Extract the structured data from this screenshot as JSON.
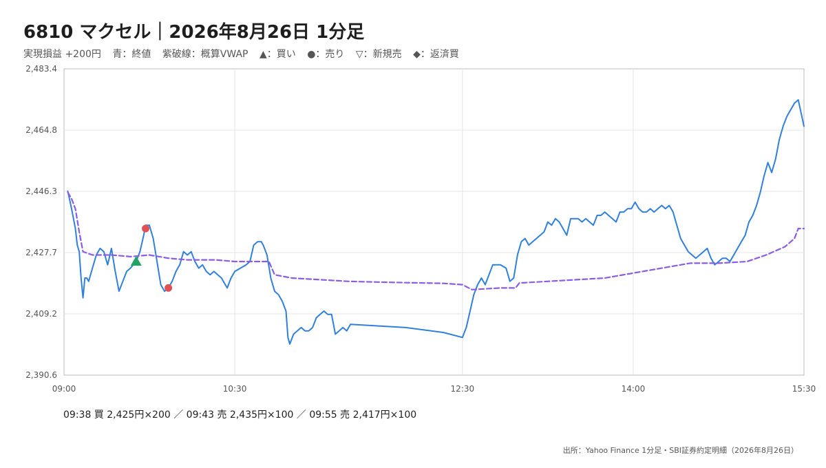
{
  "header": {
    "title": "6810 マクセル｜2026年8月26日 1分足",
    "legend": {
      "pnl": "実現損益 +200円",
      "close": "青：終値",
      "vwap": "紫破線：概算VWAP",
      "buy": "▲：買い",
      "sell": "●：売り",
      "new_sell": "▽：新規売",
      "repay": "◆：返済買"
    }
  },
  "trades_text": "09:38 買 2,425円×200 ／ 09:43 売 2,435円×100 ／ 09:55 売 2,417円×100",
  "source_text": "出所：Yahoo Finance 1分足・SBI証券約定明細（2026年8月26日）",
  "colors": {
    "close": "#2f7fdc",
    "vwap": "#8a5ce6",
    "buy": "#21a366",
    "sell": "#e05252",
    "grid": "#e6e6e6",
    "frame": "#bbbbbb"
  },
  "chart_data": {
    "type": "line",
    "x_axis": {
      "range": [
        "09:00",
        "15:30"
      ],
      "ticks": [
        "09:00",
        "10:30",
        "12:30",
        "14:00",
        "15:30"
      ]
    },
    "y_axis": {
      "range": [
        2390.6,
        2483.4
      ],
      "ticks": [
        "2,390.6",
        "2,409.2",
        "2,427.7",
        "2,446.3",
        "2,464.8",
        "2,483.4"
      ]
    },
    "grid": true,
    "series": [
      {
        "name": "終値",
        "style": "solid",
        "points": [
          [
            "09:02",
            2446.3
          ],
          [
            "09:04",
            2441
          ],
          [
            "09:06",
            2435
          ],
          [
            "09:07",
            2430
          ],
          [
            "09:08",
            2428
          ],
          [
            "09:09",
            2420
          ],
          [
            "09:10",
            2414
          ],
          [
            "09:11",
            2420
          ],
          [
            "09:12",
            2420
          ],
          [
            "09:13",
            2419
          ],
          [
            "09:15",
            2423
          ],
          [
            "09:17",
            2427
          ],
          [
            "09:19",
            2429
          ],
          [
            "09:21",
            2428
          ],
          [
            "09:23",
            2424
          ],
          [
            "09:25",
            2429
          ],
          [
            "09:27",
            2422
          ],
          [
            "09:29",
            2416
          ],
          [
            "09:31",
            2419
          ],
          [
            "09:33",
            2422
          ],
          [
            "09:35",
            2423
          ],
          [
            "09:38",
            2425
          ],
          [
            "09:40",
            2428
          ],
          [
            "09:42",
            2433
          ],
          [
            "09:43",
            2436
          ],
          [
            "09:45",
            2436
          ],
          [
            "09:47",
            2432
          ],
          [
            "09:49",
            2425
          ],
          [
            "09:51",
            2418
          ],
          [
            "09:53",
            2416
          ],
          [
            "09:55",
            2417
          ],
          [
            "09:57",
            2419
          ],
          [
            "09:59",
            2422
          ],
          [
            "10:01",
            2424
          ],
          [
            "10:03",
            2428
          ],
          [
            "10:05",
            2427
          ],
          [
            "10:07",
            2428
          ],
          [
            "10:09",
            2425
          ],
          [
            "10:11",
            2423
          ],
          [
            "10:13",
            2424
          ],
          [
            "10:15",
            2422
          ],
          [
            "10:17",
            2421
          ],
          [
            "10:19",
            2422
          ],
          [
            "10:21",
            2421
          ],
          [
            "10:23",
            2420
          ],
          [
            "10:25",
            2418
          ],
          [
            "10:26",
            2417
          ],
          [
            "10:28",
            2420
          ],
          [
            "10:30",
            2422
          ],
          [
            "10:33",
            2423
          ],
          [
            "10:36",
            2424
          ],
          [
            "10:38",
            2425
          ],
          [
            "10:40",
            2430
          ],
          [
            "10:42",
            2431
          ],
          [
            "10:44",
            2431
          ],
          [
            "10:45",
            2430
          ],
          [
            "10:47",
            2427
          ],
          [
            "10:49",
            2420
          ],
          [
            "10:51",
            2416
          ],
          [
            "10:53",
            2415
          ],
          [
            "10:55",
            2413
          ],
          [
            "10:57",
            2410
          ],
          [
            "10:58",
            2402
          ],
          [
            "10:59",
            2400
          ],
          [
            "11:01",
            2403
          ],
          [
            "11:03",
            2404
          ],
          [
            "11:05",
            2405
          ],
          [
            "11:07",
            2404
          ],
          [
            "11:09",
            2404
          ],
          [
            "11:11",
            2405
          ],
          [
            "11:13",
            2408
          ],
          [
            "11:15",
            2409
          ],
          [
            "11:17",
            2410
          ],
          [
            "11:19",
            2409
          ],
          [
            "11:21",
            2409
          ],
          [
            "11:23",
            2403
          ],
          [
            "11:25",
            2404
          ],
          [
            "11:27",
            2405
          ],
          [
            "11:29",
            2404
          ],
          [
            "11:31",
            2406
          ],
          [
            "12:00",
            2405
          ],
          [
            "12:20",
            2403.5
          ],
          [
            "12:30",
            2402
          ],
          [
            "12:32",
            2405
          ],
          [
            "12:34",
            2410
          ],
          [
            "12:36",
            2415
          ],
          [
            "12:38",
            2418
          ],
          [
            "12:40",
            2420
          ],
          [
            "12:42",
            2418
          ],
          [
            "12:44",
            2421
          ],
          [
            "12:46",
            2424
          ],
          [
            "12:48",
            2424
          ],
          [
            "12:50",
            2424
          ],
          [
            "12:53",
            2423
          ],
          [
            "12:55",
            2419
          ],
          [
            "12:57",
            2420
          ],
          [
            "12:59",
            2427
          ],
          [
            "13:01",
            2431
          ],
          [
            "13:03",
            2432
          ],
          [
            "13:05",
            2430
          ],
          [
            "13:07",
            2431
          ],
          [
            "13:09",
            2432
          ],
          [
            "13:11",
            2433
          ],
          [
            "13:13",
            2434
          ],
          [
            "13:15",
            2437
          ],
          [
            "13:17",
            2436
          ],
          [
            "13:19",
            2438
          ],
          [
            "13:21",
            2437
          ],
          [
            "13:23",
            2435
          ],
          [
            "13:25",
            2433
          ],
          [
            "13:27",
            2438
          ],
          [
            "13:29",
            2438
          ],
          [
            "13:31",
            2438
          ],
          [
            "13:33",
            2437
          ],
          [
            "13:35",
            2438
          ],
          [
            "13:37",
            2437
          ],
          [
            "13:39",
            2436
          ],
          [
            "13:41",
            2439
          ],
          [
            "13:43",
            2439
          ],
          [
            "13:45",
            2440
          ],
          [
            "13:47",
            2439
          ],
          [
            "13:49",
            2438
          ],
          [
            "13:51",
            2437
          ],
          [
            "13:53",
            2440
          ],
          [
            "13:55",
            2440
          ],
          [
            "13:57",
            2441
          ],
          [
            "13:59",
            2441
          ],
          [
            "14:01",
            2443
          ],
          [
            "14:03",
            2441
          ],
          [
            "14:05",
            2440
          ],
          [
            "14:07",
            2440
          ],
          [
            "14:09",
            2441
          ],
          [
            "14:11",
            2440
          ],
          [
            "14:13",
            2441
          ],
          [
            "14:15",
            2442
          ],
          [
            "14:17",
            2441
          ],
          [
            "14:19",
            2442
          ],
          [
            "14:21",
            2440
          ],
          [
            "14:23",
            2436
          ],
          [
            "14:25",
            2432
          ],
          [
            "14:27",
            2430
          ],
          [
            "14:29",
            2428
          ],
          [
            "14:31",
            2427
          ],
          [
            "14:33",
            2426
          ],
          [
            "14:35",
            2427
          ],
          [
            "14:37",
            2428
          ],
          [
            "14:39",
            2429
          ],
          [
            "14:41",
            2426
          ],
          [
            "14:43",
            2424
          ],
          [
            "14:45",
            2425
          ],
          [
            "14:47",
            2426
          ],
          [
            "14:49",
            2426
          ],
          [
            "14:51",
            2425
          ],
          [
            "14:53",
            2427
          ],
          [
            "14:55",
            2429
          ],
          [
            "14:57",
            2431
          ],
          [
            "14:59",
            2433
          ],
          [
            "15:01",
            2437
          ],
          [
            "15:03",
            2439
          ],
          [
            "15:05",
            2442
          ],
          [
            "15:07",
            2446
          ],
          [
            "15:09",
            2451
          ],
          [
            "15:11",
            2455
          ],
          [
            "15:13",
            2452
          ],
          [
            "15:15",
            2456
          ],
          [
            "15:17",
            2462
          ],
          [
            "15:19",
            2466
          ],
          [
            "15:21",
            2469
          ],
          [
            "15:23",
            2471
          ],
          [
            "15:25",
            2473
          ],
          [
            "15:27",
            2474
          ],
          [
            "15:30",
            2466
          ]
        ]
      },
      {
        "name": "概算VWAP",
        "style": "dashed",
        "points": [
          [
            "09:02",
            2446
          ],
          [
            "09:04",
            2444
          ],
          [
            "09:06",
            2441
          ],
          [
            "09:08",
            2434
          ],
          [
            "09:10",
            2428
          ],
          [
            "09:15",
            2427
          ],
          [
            "09:25",
            2427
          ],
          [
            "09:35",
            2426.5
          ],
          [
            "09:45",
            2427
          ],
          [
            "09:55",
            2426
          ],
          [
            "10:05",
            2425.5
          ],
          [
            "10:20",
            2425.5
          ],
          [
            "10:30",
            2425
          ],
          [
            "10:40",
            2425
          ],
          [
            "10:48",
            2425
          ],
          [
            "10:51",
            2421
          ],
          [
            "11:00",
            2420
          ],
          [
            "11:15",
            2419.5
          ],
          [
            "11:30",
            2419
          ],
          [
            "11:45",
            2418.8
          ],
          [
            "12:00",
            2418.6
          ],
          [
            "12:20",
            2418.4
          ],
          [
            "12:30",
            2418
          ],
          [
            "12:35",
            2416.5
          ],
          [
            "12:50",
            2417
          ],
          [
            "12:58",
            2417
          ],
          [
            "13:00",
            2418.5
          ],
          [
            "13:15",
            2419
          ],
          [
            "13:30",
            2419.5
          ],
          [
            "13:45",
            2420
          ],
          [
            "14:00",
            2421.5
          ],
          [
            "14:15",
            2423
          ],
          [
            "14:30",
            2424.5
          ],
          [
            "14:45",
            2424.5
          ],
          [
            "15:00",
            2425
          ],
          [
            "15:10",
            2427
          ],
          [
            "15:20",
            2429.5
          ],
          [
            "15:25",
            2432
          ],
          [
            "15:27",
            2435
          ],
          [
            "15:30",
            2435
          ]
        ]
      }
    ],
    "markers": [
      {
        "type": "buy",
        "time": "09:38",
        "price": 2425,
        "qty": 200
      },
      {
        "type": "sell",
        "time": "09:43",
        "price": 2435,
        "qty": 100
      },
      {
        "type": "sell",
        "time": "09:55",
        "price": 2417,
        "qty": 100
      }
    ]
  }
}
